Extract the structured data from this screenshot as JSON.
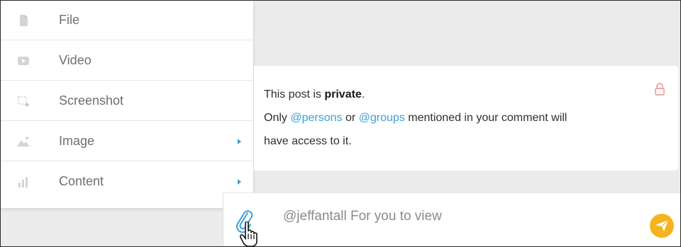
{
  "menu": {
    "items": [
      {
        "label": "File",
        "icon": "file-icon",
        "has_submenu": false
      },
      {
        "label": "Video",
        "icon": "video-icon",
        "has_submenu": false
      },
      {
        "label": "Screenshot",
        "icon": "screenshot-icon",
        "has_submenu": false
      },
      {
        "label": "Image",
        "icon": "image-icon",
        "has_submenu": true
      },
      {
        "label": "Content",
        "icon": "chart-icon",
        "has_submenu": true
      }
    ]
  },
  "notice": {
    "line1_prefix": "This post is ",
    "line1_bold": "private",
    "line1_suffix": ".",
    "line2_a": "Only ",
    "mention_persons": "@persons",
    "line2_b": " or ",
    "mention_groups": "@groups",
    "line2_c": " mentioned in your comment will",
    "line3": "have access to it.",
    "icon": "lock-icon"
  },
  "composer": {
    "value": "@jeffantall For you to view",
    "attach_icon": "paperclip-icon",
    "send_icon": "send-icon"
  },
  "colors": {
    "accent": "#3aa0d8",
    "send": "#f4b420",
    "lock": "#f28c8c",
    "background": "#ebebeb"
  }
}
